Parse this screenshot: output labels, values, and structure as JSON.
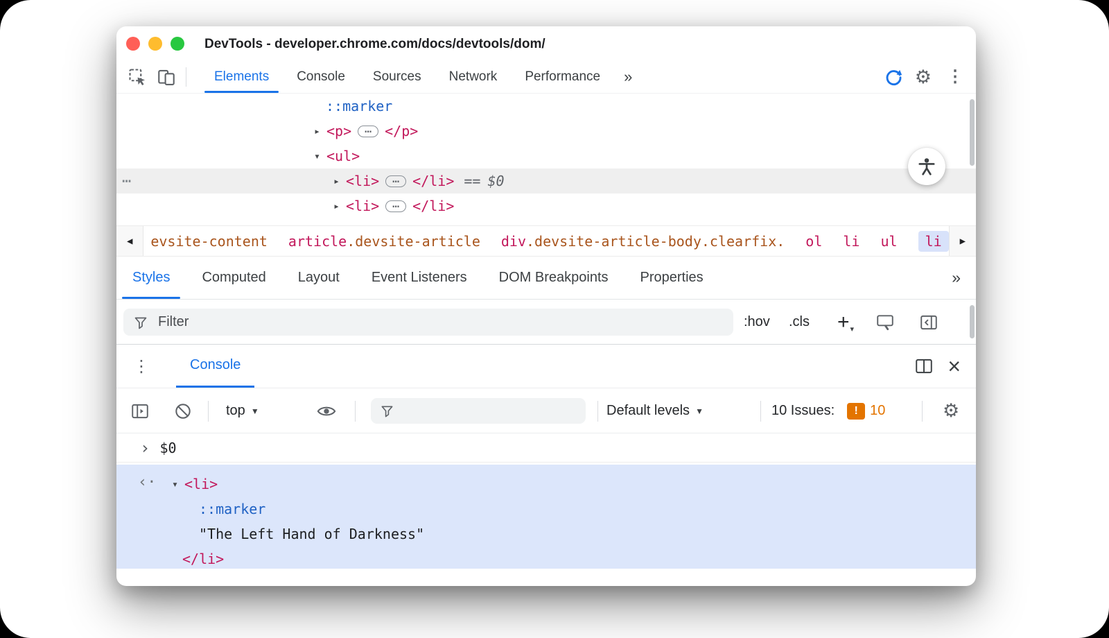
{
  "window": {
    "title": "DevTools - developer.chrome.com/docs/devtools/dom/"
  },
  "palette": {
    "accent_blue": "#1a73e8",
    "tag_pink": "#c2185b",
    "class_orange": "#a9551d",
    "pseudo_blue": "#2062c4",
    "issues_orange": "#e37400",
    "selected_crumb_bg": "#d8e2fa",
    "console_result_bg": "#dce6fb",
    "selected_row_bg": "#efefef"
  },
  "glyphs": {
    "collapsed": "▸",
    "expanded": "▾",
    "ellipsis": "…",
    "more_tabs": "»",
    "overflow_kebab": "⋮",
    "overflow_dots": "⋯",
    "back": "◀",
    "forward": "▶",
    "caret_down": "▼",
    "prompt": "›",
    "result_arrow": "‹·",
    "close": "×",
    "gear": "⚙"
  },
  "main_toolbar": {
    "tabs": [
      {
        "label": "Elements",
        "active": true
      },
      {
        "label": "Console",
        "active": false
      },
      {
        "label": "Sources",
        "active": false
      },
      {
        "label": "Network",
        "active": false
      },
      {
        "label": "Performance",
        "active": false
      }
    ]
  },
  "dom_tree": {
    "rows": [
      {
        "pseudo": "::marker"
      },
      {
        "arrow": "▸",
        "open": "<p>",
        "ellipsis": "…",
        "close": "</p>"
      },
      {
        "arrow": "▾",
        "open": "<ul>"
      },
      {
        "gutter": "⋯",
        "arrow": "▸",
        "open": "<li>",
        "ellipsis": "…",
        "close": "</li>",
        "eq": "==",
        "ref": "$0",
        "selected": true
      },
      {
        "arrow": "▸",
        "open": "<li>",
        "ellipsis": "…",
        "close": "</li>"
      }
    ]
  },
  "breadcrumbs": {
    "back": "◀",
    "forward": "▶",
    "items": [
      {
        "classes": "evsite-content"
      },
      {
        "tag": "article",
        "classes": ".devsite-article"
      },
      {
        "tag": "div",
        "classes": ".devsite-article-body.clearfix."
      },
      {
        "tag": "ol"
      },
      {
        "tag": "li"
      },
      {
        "tag": "ul"
      },
      {
        "tag": "li",
        "selected": true
      }
    ]
  },
  "styles_panel": {
    "tabs": [
      {
        "label": "Styles",
        "active": true
      },
      {
        "label": "Computed",
        "active": false
      },
      {
        "label": "Layout",
        "active": false
      },
      {
        "label": "Event Listeners",
        "active": false
      },
      {
        "label": "DOM Breakpoints",
        "active": false
      },
      {
        "label": "Properties",
        "active": false
      }
    ],
    "more": "»",
    "filter_placeholder": "Filter",
    "hov": ":hov",
    "cls": ".cls",
    "plus": "+"
  },
  "console_drawer": {
    "menu": "⋮",
    "tab": "Console",
    "close": "×",
    "toolbar": {
      "top": "top",
      "default_levels": "Default levels",
      "issues_label": "10 Issues:",
      "issues_bang": "!",
      "issues_count": "10"
    },
    "echo": {
      "prompt": "›",
      "expression": "$0"
    },
    "result": {
      "marker": "‹·",
      "arrow": "▾",
      "open": "<li>",
      "pseudo": "::marker",
      "text": "\"The Left Hand of Darkness\"",
      "close": "</li>"
    }
  }
}
